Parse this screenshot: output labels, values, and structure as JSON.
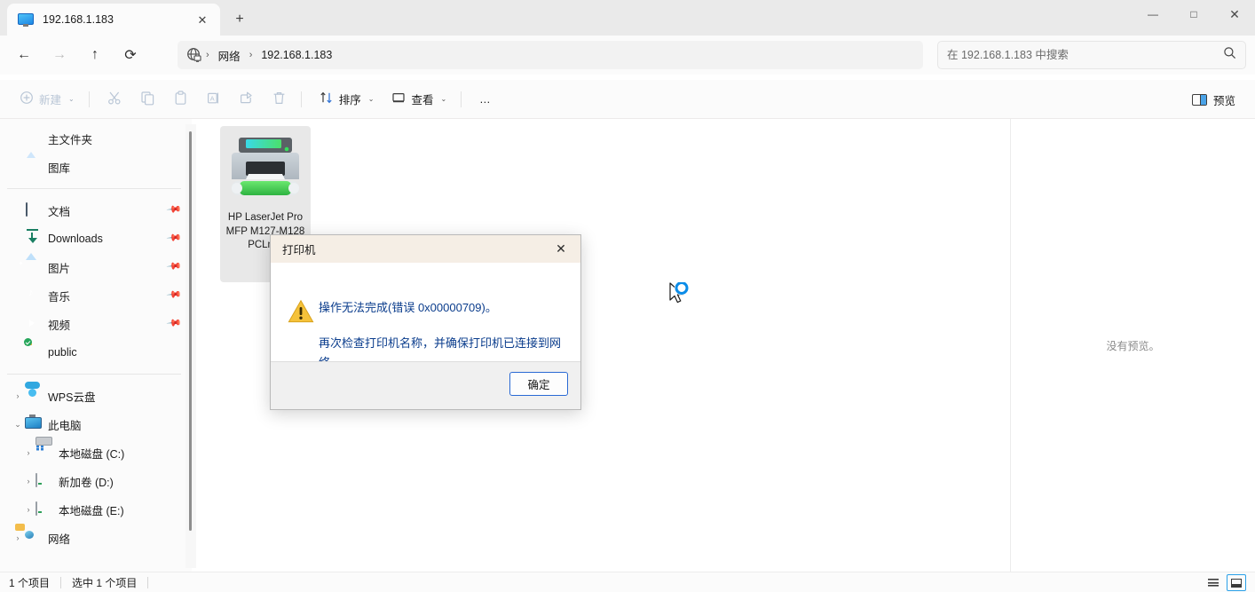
{
  "window": {
    "tab_title": "192.168.1.183",
    "tab_icon": "network-computer-icon",
    "new_tab_label": "+",
    "minimize": "—",
    "maximize": "□",
    "close": "✕"
  },
  "nav": {
    "back": "←",
    "forward": "→",
    "up": "↑",
    "refresh": "⟳",
    "breadcrumb": [
      {
        "label": "网络"
      },
      {
        "label": "192.168.1.183"
      }
    ],
    "separator": "›"
  },
  "search": {
    "placeholder": "在 192.168.1.183 中搜索",
    "icon": "search-icon",
    "value": ""
  },
  "toolbar": {
    "new_label": "新建",
    "new_icon": "plus-circle-icon",
    "cut_icon": "scissors-icon",
    "copy_icon": "copy-icon",
    "paste_icon": "clipboard-icon",
    "rename_icon": "rename-icon",
    "share_icon": "share-icon",
    "delete_icon": "trash-icon",
    "sort_label": "排序",
    "sort_icon": "sort-arrows-icon",
    "view_label": "查看",
    "view_icon": "view-monitor-icon",
    "more_label": "…",
    "caret": "⌄",
    "preview_label": "预览",
    "preview_icon": "preview-pane-icon"
  },
  "sidebar": {
    "quick": [
      {
        "label": "主文件夹",
        "icon": "home-icon",
        "pinned": false
      },
      {
        "label": "图库",
        "icon": "gallery-icon",
        "pinned": false
      }
    ],
    "pinned": [
      {
        "label": "文档",
        "icon": "documents-icon",
        "pinned": true
      },
      {
        "label": "Downloads",
        "icon": "downloads-icon",
        "pinned": true
      },
      {
        "label": "图片",
        "icon": "pictures-icon",
        "pinned": true
      },
      {
        "label": "音乐",
        "icon": "music-icon",
        "pinned": true
      },
      {
        "label": "视频",
        "icon": "videos-icon",
        "pinned": true
      },
      {
        "label": "public",
        "icon": "folder-shared-icon",
        "pinned": false
      }
    ],
    "tree": [
      {
        "label": "WPS云盘",
        "icon": "cloud-icon",
        "chevron": "›",
        "expanded": false,
        "indent": 0
      },
      {
        "label": "此电脑",
        "icon": "this-pc-icon",
        "chevron": "⌄",
        "expanded": true,
        "indent": 0
      },
      {
        "label": "本地磁盘 (C:)",
        "icon": "system-drive-icon",
        "chevron": "›",
        "expanded": false,
        "indent": 1
      },
      {
        "label": "新加卷 (D:)",
        "icon": "drive-icon",
        "chevron": "›",
        "expanded": false,
        "indent": 1
      },
      {
        "label": "本地磁盘 (E:)",
        "icon": "drive-icon",
        "chevron": "›",
        "expanded": false,
        "indent": 1
      },
      {
        "label": "网络",
        "icon": "network-icon",
        "chevron": "›",
        "expanded": false,
        "indent": 0
      }
    ]
  },
  "content": {
    "items": [
      {
        "name": "HP LaserJet Pro MFP M127-M128 PCLmS",
        "icon": "printer-icon",
        "selected": true
      }
    ]
  },
  "preview": {
    "empty_text": "没有预览。"
  },
  "status": {
    "item_count": "1 个项目",
    "selection": "选中 1 个项目",
    "view_list_icon": "list-view-icon",
    "view_tiles_icon": "large-icons-view-icon"
  },
  "dialog": {
    "title": "打印机",
    "close": "✕",
    "icon": "warning-triangle-icon",
    "message_line1": "操作无法完成(错误 0x00000709)。",
    "message_line2": "再次检查打印机名称，并确保打印机已连接到网络。",
    "ok_label": "确定"
  },
  "cursor": {
    "icon": "arrow-busy-cursor"
  },
  "colors": {
    "accent": "#2a6ad4",
    "dialog_titlebar": "#f5eee5",
    "dialog_text": "#0a3c8c",
    "selection": "#e8e8e8",
    "warning": "#f5c23a"
  }
}
